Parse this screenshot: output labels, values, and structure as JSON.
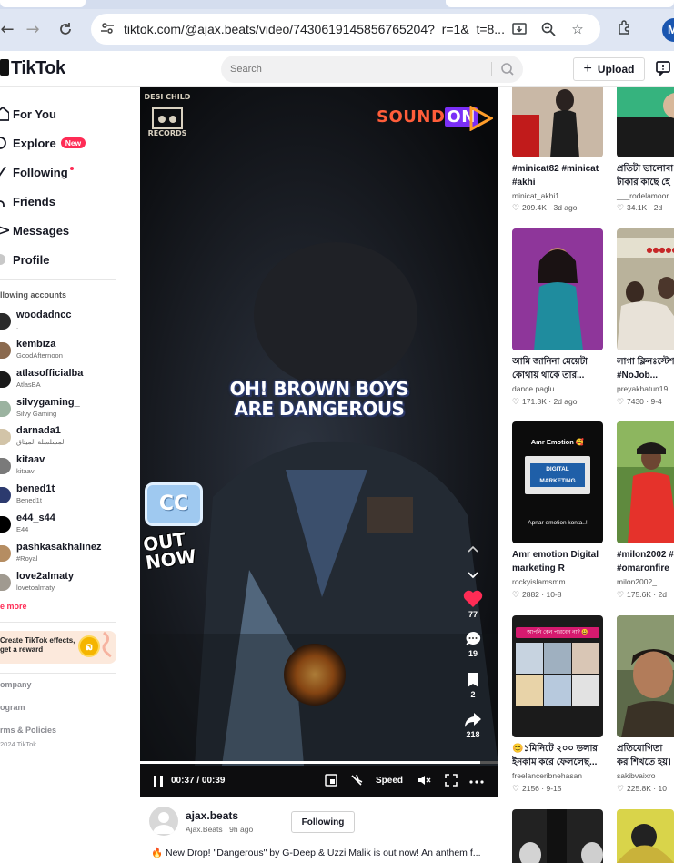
{
  "browser": {
    "url": "tiktok.com/@ajax.beats/video/7430619145856765204?_r=1&_t=8...",
    "profile_initial": "M"
  },
  "header": {
    "logo": "TikTok",
    "search_placeholder": "Search",
    "upload_label": "Upload"
  },
  "sidebar": {
    "nav": [
      {
        "label": "For You"
      },
      {
        "label": "Explore",
        "badge": "New"
      },
      {
        "label": "Following"
      },
      {
        "label": "Friends"
      },
      {
        "label": "Messages"
      },
      {
        "label": "Profile"
      }
    ],
    "following_title": "llowing accounts",
    "accounts": [
      {
        "name": "woodadncc",
        "sub": "."
      },
      {
        "name": "kembiza",
        "sub": "GoodAfternoon"
      },
      {
        "name": "atlasofficialba",
        "sub": "AtlasBA"
      },
      {
        "name": "silvygaming_",
        "sub": "Silvy Gaming"
      },
      {
        "name": "darnada1",
        "sub": "المسلسلة الميثاق"
      },
      {
        "name": "kitaav",
        "sub": "kitaav"
      },
      {
        "name": "bened1t",
        "sub": "Bened1t"
      },
      {
        "name": "e44_s44",
        "sub": "E44"
      },
      {
        "name": "pashkasakhalinez",
        "sub": "#Royal"
      },
      {
        "name": "love2almaty",
        "sub": "lovetoalmaty"
      }
    ],
    "see_more": "e more",
    "effects_banner": "Create TikTok effects, get a reward",
    "footer": {
      "company": "ompany",
      "program": "ogram",
      "terms": "rms & Policies",
      "copyright": "2024 TikTok"
    }
  },
  "video": {
    "caption_line1": "OH! BROWN BOYS",
    "caption_line2": "ARE DANGEROUS",
    "cc_badge": "CC",
    "out_now_line1": "OUT",
    "out_now_line2": "NOW",
    "logo_left_line1": "DESI CHILD",
    "logo_left_line2": "RECORDS",
    "logo_right": "SOUND",
    "logo_right_on": "ON",
    "likes": "77",
    "comments": "19",
    "saves": "2",
    "shares": "218",
    "time": "00:37 / 00:39",
    "progress": 0.95,
    "speed_label": "Speed"
  },
  "author": {
    "name": "ajax.beats",
    "sub": "Ajax.Beats · 9h ago",
    "follow_label": "Following",
    "description": "New Drop! \"Dangerous\" by G-Deep & Uzzi Malik is out now! An anthem f... "
  },
  "feed": [
    {
      "title": "#minicat82 #minicat #akhi",
      "user": "minicat_akhi1",
      "stats": "209.4K · 3d ago"
    },
    {
      "title": "প্রতিটা ভালোবা টাকার কাছে হে",
      "user": "___rodelamoor",
      "stats": "34.1K · 2d"
    },
    {
      "title": "আমি জানিনা মেয়েটা কোথায় থাকে তার...",
      "user": "dance.paglu",
      "stats": "171.3K · 2d ago"
    },
    {
      "title": "লাগা ক্লিনঃস্টেশ #NoJob...",
      "user": "preyakhatun19",
      "stats": "7430 · 9-4"
    },
    {
      "title": "Amr emotion Digital marketing R Apnr...!...",
      "user": "rockyislamsmm",
      "stats": "2882 · 10-8",
      "thumb_top": "Amr Emotion 🥰",
      "thumb_mid": "DIGITAL MARKETING",
      "thumb_bottom": "Apnar emotion konta..!"
    },
    {
      "title": "#milon2002 # #omaronfire",
      "user": "milon2002_",
      "stats": "175.6K · 2d"
    },
    {
      "title": "😊১মিনিটে ২০০ ডলার ইনকাম করে ফেললেছ...",
      "user": "freelanceribnehasan",
      "stats": "2156 · 9-15",
      "thumb_top": "আপনি কেন পারবেন না? 😃"
    },
    {
      "title": "প্রতিযোগিতা কর শিখতে হয়। শে",
      "user": "sakibvaixro",
      "stats": "225.8K · 10"
    }
  ]
}
